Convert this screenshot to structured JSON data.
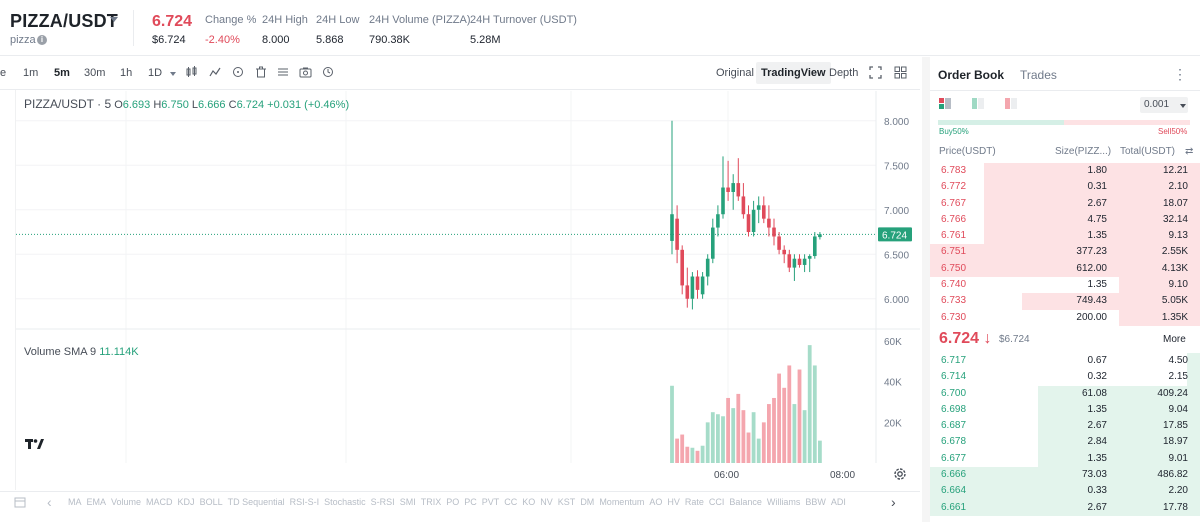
{
  "header": {
    "pair": "PIZZA/USDT",
    "token_name": "pizza",
    "last_price": "6.724",
    "last_price_usd": "$6.724",
    "stats": [
      {
        "label": "Change %",
        "value": "-2.40%",
        "negative": true
      },
      {
        "label": "24H High",
        "value": "8.000"
      },
      {
        "label": "24H Low",
        "value": "5.868"
      },
      {
        "label": "24H Volume (PIZZA)",
        "value": "790.38K"
      },
      {
        "label": "24H Turnover (USDT)",
        "value": "5.28M"
      }
    ]
  },
  "toolbar": {
    "intervals": [
      "1m",
      "5m",
      "30m",
      "1h",
      "1D"
    ],
    "active_interval": "5m",
    "views": [
      "Original",
      "TradingView",
      "Depth"
    ],
    "active_view": "TradingView"
  },
  "legend": {
    "symbol": "PIZZA/USDT · 5",
    "o_label": "O",
    "o": "6.693",
    "h_label": "H",
    "h": "6.750",
    "l_label": "L",
    "l": "6.666",
    "c_label": "C",
    "c": "6.724",
    "change": "+0.031 (+0.46%)",
    "volume_label": "Volume SMA 9",
    "volume_value": "11.114K"
  },
  "chart_data": {
    "type": "candlestick",
    "interval": "5m",
    "current_price": 6.724,
    "current_price_label": "6.724",
    "price_axis": {
      "ticks": [
        "8.000",
        "7.500",
        "7.000",
        "6.500",
        "6.000"
      ],
      "range": [
        5.75,
        8.2
      ]
    },
    "volume_axis": {
      "ticks": [
        "60K",
        "40K",
        "20K"
      ],
      "range": [
        0,
        62000
      ]
    },
    "time_axis": {
      "ticks": [
        "06:00",
        "08:00"
      ]
    },
    "candles": [
      {
        "o": 6.65,
        "h": 8.0,
        "l": 6.5,
        "c": 6.95
      },
      {
        "o": 6.9,
        "h": 7.05,
        "l": 6.4,
        "c": 6.55
      },
      {
        "o": 6.55,
        "h": 6.6,
        "l": 6.05,
        "c": 6.15
      },
      {
        "o": 6.15,
        "h": 6.35,
        "l": 5.9,
        "c": 6.0
      },
      {
        "o": 6.0,
        "h": 6.3,
        "l": 5.88,
        "c": 6.25
      },
      {
        "o": 6.25,
        "h": 6.32,
        "l": 6.0,
        "c": 6.1
      },
      {
        "o": 6.05,
        "h": 6.3,
        "l": 6.0,
        "c": 6.25
      },
      {
        "o": 6.25,
        "h": 6.5,
        "l": 6.15,
        "c": 6.45
      },
      {
        "o": 6.45,
        "h": 6.9,
        "l": 6.4,
        "c": 6.8
      },
      {
        "o": 6.8,
        "h": 7.05,
        "l": 6.7,
        "c": 6.95
      },
      {
        "o": 6.95,
        "h": 7.6,
        "l": 6.9,
        "c": 7.25
      },
      {
        "o": 7.25,
        "h": 7.55,
        "l": 7.1,
        "c": 7.2
      },
      {
        "o": 7.2,
        "h": 7.4,
        "l": 7.0,
        "c": 7.3
      },
      {
        "o": 7.3,
        "h": 7.58,
        "l": 7.1,
        "c": 7.15
      },
      {
        "o": 7.15,
        "h": 7.3,
        "l": 6.9,
        "c": 6.95
      },
      {
        "o": 6.95,
        "h": 7.05,
        "l": 6.7,
        "c": 6.75
      },
      {
        "o": 6.75,
        "h": 7.1,
        "l": 6.7,
        "c": 7.0
      },
      {
        "o": 7.0,
        "h": 7.15,
        "l": 6.85,
        "c": 7.05
      },
      {
        "o": 7.05,
        "h": 7.15,
        "l": 6.85,
        "c": 6.9
      },
      {
        "o": 6.9,
        "h": 7.05,
        "l": 6.7,
        "c": 6.8
      },
      {
        "o": 6.8,
        "h": 6.9,
        "l": 6.6,
        "c": 6.7
      },
      {
        "o": 6.7,
        "h": 6.75,
        "l": 6.5,
        "c": 6.55
      },
      {
        "o": 6.55,
        "h": 6.6,
        "l": 6.4,
        "c": 6.5
      },
      {
        "o": 6.5,
        "h": 6.55,
        "l": 6.3,
        "c": 6.35
      },
      {
        "o": 6.35,
        "h": 6.5,
        "l": 6.2,
        "c": 6.45
      },
      {
        "o": 6.45,
        "h": 6.5,
        "l": 6.35,
        "c": 6.38
      },
      {
        "o": 6.38,
        "h": 6.5,
        "l": 6.3,
        "c": 6.45
      },
      {
        "o": 6.45,
        "h": 6.5,
        "l": 6.3,
        "c": 6.48
      },
      {
        "o": 6.48,
        "h": 6.75,
        "l": 6.45,
        "c": 6.7
      },
      {
        "o": 6.693,
        "h": 6.75,
        "l": 6.666,
        "c": 6.724
      }
    ],
    "volumes": [
      38000,
      12000,
      14000,
      8000,
      7500,
      6000,
      8500,
      20000,
      25000,
      24000,
      23000,
      32000,
      27000,
      34000,
      26000,
      15000,
      25000,
      12000,
      20000,
      29000,
      32000,
      44000,
      37000,
      48000,
      29000,
      46000,
      26000,
      58000,
      48000,
      11000
    ]
  },
  "indicators": [
    "MA",
    "EMA",
    "Volume",
    "MACD",
    "KDJ",
    "BOLL",
    "TD Sequential",
    "RSI-S-I",
    "Stochastic",
    "S-RSI",
    "SMI",
    "TRIX",
    "PO",
    "PC",
    "PVT",
    "CC",
    "KO",
    "NV",
    "KST",
    "DM",
    "Momentum",
    "AO",
    "HV",
    "Rate",
    "CCI",
    "Balance",
    "Williams",
    "BBW",
    "ADI"
  ],
  "orderbook": {
    "tabs": [
      "Order Book",
      "Trades"
    ],
    "active_tab": "Order Book",
    "precision": "0.001",
    "buy_ratio_label": "Buy50%",
    "sell_ratio_label": "Sell50%",
    "buy_ratio": 0.5,
    "headers": {
      "price": "Price(USDT)",
      "size": "Size(PIZZ...)",
      "total": "Total(USDT)"
    },
    "asks": [
      {
        "price": "6.783",
        "size": "1.80",
        "total": "12.21",
        "depth": 0.8
      },
      {
        "price": "6.772",
        "size": "0.31",
        "total": "2.10",
        "depth": 0.8
      },
      {
        "price": "6.767",
        "size": "2.67",
        "total": "18.07",
        "depth": 0.8
      },
      {
        "price": "6.766",
        "size": "4.75",
        "total": "32.14",
        "depth": 0.8
      },
      {
        "price": "6.761",
        "size": "1.35",
        "total": "9.13",
        "depth": 0.8
      },
      {
        "price": "6.751",
        "size": "377.23",
        "total": "2.55K",
        "depth": 1.0
      },
      {
        "price": "6.750",
        "size": "612.00",
        "total": "4.13K",
        "depth": 1.0
      },
      {
        "price": "6.740",
        "size": "1.35",
        "total": "9.10",
        "depth": 0.3
      },
      {
        "price": "6.733",
        "size": "749.43",
        "total": "5.05K",
        "depth": 0.66
      },
      {
        "price": "6.730",
        "size": "200.00",
        "total": "1.35K",
        "depth": 0.3
      }
    ],
    "mid_price": "6.724",
    "mid_price_arrow": "↓",
    "mid_price_usd": "$6.724",
    "more_label": "More",
    "bids": [
      {
        "price": "6.717",
        "size": "0.67",
        "total": "4.50",
        "depth": 0.05
      },
      {
        "price": "6.714",
        "size": "0.32",
        "total": "2.15",
        "depth": 0.05
      },
      {
        "price": "6.700",
        "size": "61.08",
        "total": "409.24",
        "depth": 0.6
      },
      {
        "price": "6.698",
        "size": "1.35",
        "total": "9.04",
        "depth": 0.6
      },
      {
        "price": "6.687",
        "size": "2.67",
        "total": "17.85",
        "depth": 0.6
      },
      {
        "price": "6.678",
        "size": "2.84",
        "total": "18.97",
        "depth": 0.6
      },
      {
        "price": "6.677",
        "size": "1.35",
        "total": "9.01",
        "depth": 0.6
      },
      {
        "price": "6.666",
        "size": "73.03",
        "total": "486.82",
        "depth": 1.0
      },
      {
        "price": "6.664",
        "size": "0.33",
        "total": "2.20",
        "depth": 1.0
      },
      {
        "price": "6.661",
        "size": "2.67",
        "total": "17.78",
        "depth": 1.0
      }
    ]
  },
  "colors": {
    "up": "#26a17b",
    "down": "#e04a5a",
    "up_volume": "#a6dcc9",
    "down_volume": "#f4a6ae"
  }
}
